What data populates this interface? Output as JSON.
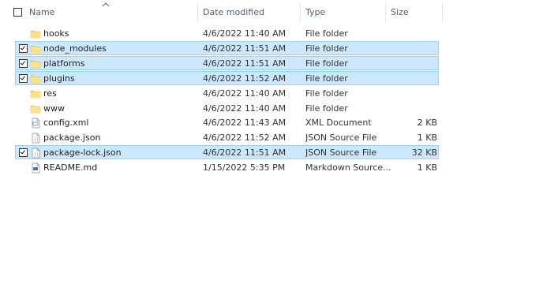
{
  "columns": {
    "name": "Name",
    "date_modified": "Date modified",
    "type": "Type",
    "size": "Size"
  },
  "rows": [
    {
      "name": "hooks",
      "date": "4/6/2022 11:40 AM",
      "type": "File folder",
      "size": "",
      "icon": "folder-icon",
      "selected": false
    },
    {
      "name": "node_modules",
      "date": "4/6/2022 11:51 AM",
      "type": "File folder",
      "size": "",
      "icon": "folder-icon",
      "selected": true
    },
    {
      "name": "platforms",
      "date": "4/6/2022 11:51 AM",
      "type": "File folder",
      "size": "",
      "icon": "folder-icon",
      "selected": true
    },
    {
      "name": "plugins",
      "date": "4/6/2022 11:52 AM",
      "type": "File folder",
      "size": "",
      "icon": "folder-icon",
      "selected": true
    },
    {
      "name": "res",
      "date": "4/6/2022 11:40 AM",
      "type": "File folder",
      "size": "",
      "icon": "folder-icon",
      "selected": false
    },
    {
      "name": "www",
      "date": "4/6/2022 11:40 AM",
      "type": "File folder",
      "size": "",
      "icon": "folder-icon",
      "selected": false
    },
    {
      "name": "config.xml",
      "date": "4/6/2022 11:43 AM",
      "type": "XML Document",
      "size": "2 KB",
      "icon": "xml-file-icon",
      "selected": false
    },
    {
      "name": "package.json",
      "date": "4/6/2022 11:52 AM",
      "type": "JSON Source File",
      "size": "1 KB",
      "icon": "json-file-icon",
      "selected": false
    },
    {
      "name": "package-lock.json",
      "date": "4/6/2022 11:51 AM",
      "type": "JSON Source File",
      "size": "32 KB",
      "icon": "json-file-icon",
      "selected": true
    },
    {
      "name": "README.md",
      "date": "1/15/2022 5:35 PM",
      "type": "Markdown Source...",
      "size": "1 KB",
      "icon": "markdown-file-icon",
      "selected": false
    }
  ],
  "colors": {
    "selection_bg": "#cce8ff",
    "selection_border": "#99d1ff",
    "header_text": "#4c607a",
    "folder": "#ffd767"
  }
}
